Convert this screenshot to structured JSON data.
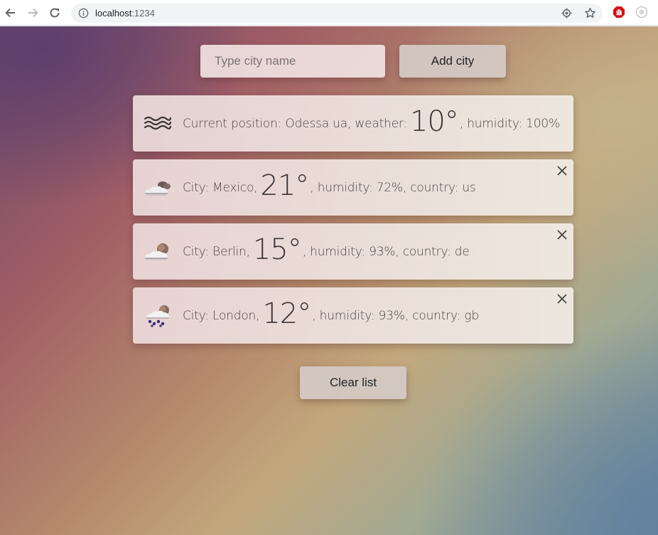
{
  "browser": {
    "url_host": "localhost",
    "url_port": ":1234"
  },
  "search": {
    "placeholder": "Type city name",
    "add_label": "Add city"
  },
  "current": {
    "prefix": "Current position: Odessa ua, weather: ",
    "temp": "10°",
    "suffix": ", humidity: 100%",
    "icon": "fog-icon"
  },
  "cities": [
    {
      "prefix": "City: Mexico,",
      "temp": "21°",
      "suffix": ", humidity: 72%, country: us",
      "icon": "cloudy-icon"
    },
    {
      "prefix": "City: Berlin, ",
      "temp": "15°",
      "suffix": ", humidity: 93%, country: de",
      "icon": "partly-cloudy-icon"
    },
    {
      "prefix": "City: London, ",
      "temp": "12°",
      "suffix": ", humidity: 93%, country: gb",
      "icon": "rain-icon"
    }
  ],
  "clear_label": "Clear list"
}
